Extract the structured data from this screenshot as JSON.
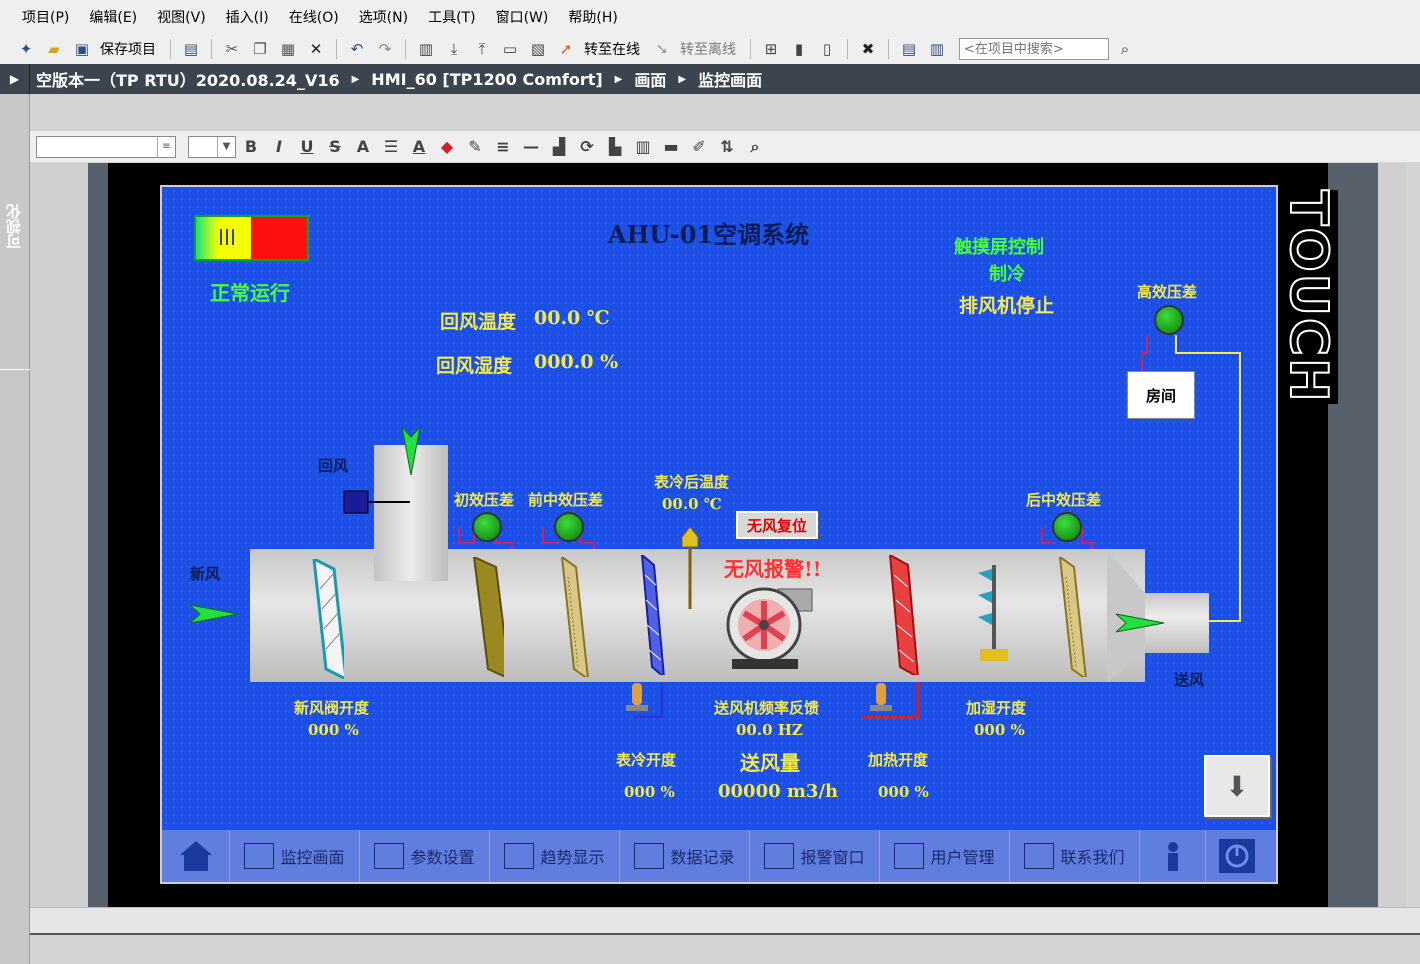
{
  "menu": [
    "项目(P)",
    "编辑(E)",
    "视图(V)",
    "插入(I)",
    "在线(O)",
    "选项(N)",
    "工具(T)",
    "窗口(W)",
    "帮助(H)"
  ],
  "toolbar": {
    "save_label": "保存项目",
    "go_online_label": "转至在线",
    "go_offline_label": "转至离线",
    "search_placeholder": "<在项目中搜索>"
  },
  "breadcrumb": [
    "空版本一（TP RTU）2020.08.24_V16",
    "HMI_60 [TP1200 Comfort]",
    "画面",
    "监控画面"
  ],
  "left_panel_label": "可视化",
  "format_toolbar": [
    "B",
    "I",
    "U",
    "S",
    "A"
  ],
  "bezel_label": "TOUCH",
  "hmi": {
    "title": "AHU-01空调系统",
    "status_running": "正常运行",
    "touch_control": "触摸屏控制",
    "mode": "制冷",
    "exhaust_status": "排风机停止",
    "return_temp_label": "回风温度",
    "return_temp_value": "00.0 ℃",
    "return_hum_label": "回风湿度",
    "return_hum_value": "000.0 %",
    "return_air": "回风",
    "fresh_air": "新风",
    "supply_air": "送风",
    "primary_dp": "初效压差",
    "mid_dp": "前中效压差",
    "post_mid_dp": "后中效压差",
    "hepa_dp": "高效压差",
    "room": "房间",
    "cooling_temp_label": "表冷后温度",
    "cooling_temp_value": "00.0 ℃",
    "reset_button": "无风复位",
    "alarm": "无风报警!!",
    "fresh_damper_label": "新风阀开度",
    "fresh_damper_value": "000 %",
    "cooling_valve_label": "表冷开度",
    "cooling_valve_value": "000 %",
    "fan_freq_label": "送风机频率反馈",
    "fan_freq_value": "00.0 HZ",
    "airflow_label": "送风量",
    "airflow_value": "00000 m3/h",
    "heating_label": "加热开度",
    "heating_value": "000 %",
    "humid_label": "加湿开度",
    "humid_value": "000 %"
  },
  "nav": [
    "监控画面",
    "参数设置",
    "趋势显示",
    "数据记录",
    "报警窗口",
    "用户管理",
    "联系我们"
  ],
  "colors": {
    "screen_bg": "#1c4fe6",
    "label_yellow": "#f2e94a",
    "label_green": "#45ff3a",
    "alarm_red": "#ff3030"
  }
}
